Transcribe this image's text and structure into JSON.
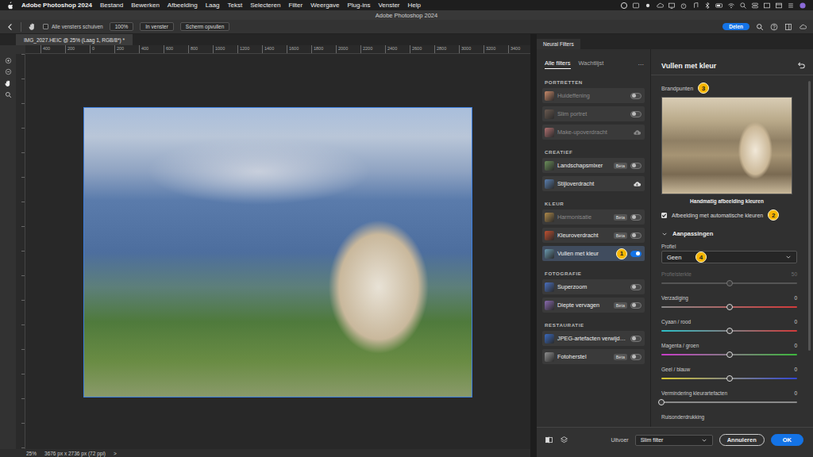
{
  "menubar": {
    "app": "Adobe Photoshop 2024",
    "items": [
      "Bestand",
      "Bewerken",
      "Afbeelding",
      "Laag",
      "Tekst",
      "Selecteren",
      "Filter",
      "Weergave",
      "Plug-ins",
      "Venster",
      "Help"
    ]
  },
  "window": {
    "title": "Adobe Photoshop 2024"
  },
  "options_bar": {
    "align_all": {
      "label": "Alle vensters schuiven",
      "checked": false
    },
    "buttons": [
      "100%",
      "In venster",
      "Scherm opvullen"
    ],
    "share": "Delen"
  },
  "document": {
    "tab": "IMG_2027.HEIC @ 25% (Laag 1, RGB/8*) *",
    "ruler": [
      "400",
      "200",
      "0",
      "200",
      "400",
      "600",
      "800",
      "1000",
      "1200",
      "1400",
      "1600",
      "1800",
      "2000",
      "2200",
      "2400",
      "2600",
      "2800",
      "3000",
      "3200",
      "3400"
    ]
  },
  "status_bar": {
    "zoom": "25%",
    "size": "3676 px x 2736 px (72 ppi)",
    "more": ">"
  },
  "neural_filters": {
    "tab": "Neural Filters",
    "filter_tabs": [
      {
        "label": "Alle filters",
        "selected": true
      },
      {
        "label": "Wachtlijst",
        "selected": false
      }
    ],
    "more": "···",
    "sections": [
      {
        "title": "PORTRETTEN",
        "items": [
          {
            "label": "Huideffening",
            "kind": "toggle",
            "on": false,
            "disabled": true,
            "selected": false
          },
          {
            "label": "Slim portret",
            "kind": "toggle",
            "on": false,
            "disabled": true,
            "selected": false
          },
          {
            "label": "Make-upoverdracht",
            "kind": "download",
            "disabled": true,
            "selected": false
          }
        ]
      },
      {
        "title": "CREATIEF",
        "items": [
          {
            "label": "Landschapsmixer",
            "beta": "Bèta",
            "kind": "toggle",
            "on": false,
            "disabled": false,
            "selected": false
          },
          {
            "label": "Stijloverdracht",
            "kind": "download",
            "disabled": false,
            "selected": false
          }
        ]
      },
      {
        "title": "KLEUR",
        "items": [
          {
            "label": "Harmonisatie",
            "beta": "Bèta",
            "kind": "toggle",
            "on": false,
            "disabled": true,
            "selected": false
          },
          {
            "label": "Kleuroverdracht",
            "beta": "Bèta",
            "kind": "toggle",
            "on": false,
            "disabled": false,
            "selected": false
          },
          {
            "label": "Vullen met kleur",
            "annotation": "1",
            "kind": "toggle",
            "on": true,
            "disabled": false,
            "selected": true
          }
        ]
      },
      {
        "title": "FOTOGRAFIE",
        "items": [
          {
            "label": "Superzoom",
            "kind": "toggle",
            "on": false,
            "disabled": false,
            "selected": false
          },
          {
            "label": "Diepte vervagen",
            "beta": "Bèta",
            "kind": "toggle",
            "on": false,
            "disabled": false,
            "selected": false
          }
        ]
      },
      {
        "title": "RESTAURATIE",
        "items": [
          {
            "label": "JPEG-artefacten verwijd…",
            "kind": "toggle",
            "on": false,
            "disabled": false,
            "selected": false
          },
          {
            "label": "Fotoherstel",
            "beta": "Bèta",
            "kind": "toggle",
            "on": false,
            "disabled": false,
            "selected": false
          }
        ]
      }
    ],
    "detail": {
      "title": "Vullen met kleur",
      "focus_points": {
        "label": "Brandpunten",
        "badge": "3"
      },
      "preview_caption": "Handmatig afbeelding kleuren",
      "auto_color": {
        "label": "Afbeelding met automatische kleuren",
        "checked": true,
        "badge": "2"
      },
      "adjustments": {
        "label": "Aanpassingen",
        "expanded": true
      },
      "profile": {
        "label": "Profiel",
        "value": "Geen",
        "badge": "4"
      },
      "sliders": [
        {
          "label": "Profielsterkte",
          "kind": "slider",
          "reading": "50",
          "level": 0.5,
          "disabled": true,
          "colors": [
            "#555555",
            "#555555"
          ]
        },
        {
          "label": "Verzadiging",
          "kind": "slider",
          "reading": "0",
          "level": 0.5,
          "disabled": false,
          "colors": [
            "#8a8a8a",
            "#d23a3a"
          ]
        },
        {
          "label": "Cyaan / rood",
          "kind": "slider",
          "reading": "0",
          "level": 0.5,
          "disabled": false,
          "colors": [
            "#2cc0c8",
            "#d23a3a"
          ]
        },
        {
          "label": "Magenta / groen",
          "kind": "slider",
          "reading": "0",
          "level": 0.5,
          "disabled": false,
          "colors": [
            "#c83cc8",
            "#3cb83c"
          ]
        },
        {
          "label": "Geel / blauw",
          "kind": "slider",
          "reading": "0",
          "level": 0.5,
          "disabled": false,
          "colors": [
            "#d6c832",
            "#3246d2"
          ]
        },
        {
          "label": "Vermindering kleurartefacten",
          "kind": "slider",
          "reading": "0",
          "level": 0,
          "disabled": false,
          "colors": [
            "#8a8a8a",
            "#8a8a8a"
          ]
        },
        {
          "label": "Ruisonderdrukking",
          "kind": "label"
        }
      ]
    },
    "footer": {
      "output_label": "Uitvoer",
      "output": "Slim filter",
      "cancel": "Annuleren",
      "ok": "OK"
    }
  }
}
